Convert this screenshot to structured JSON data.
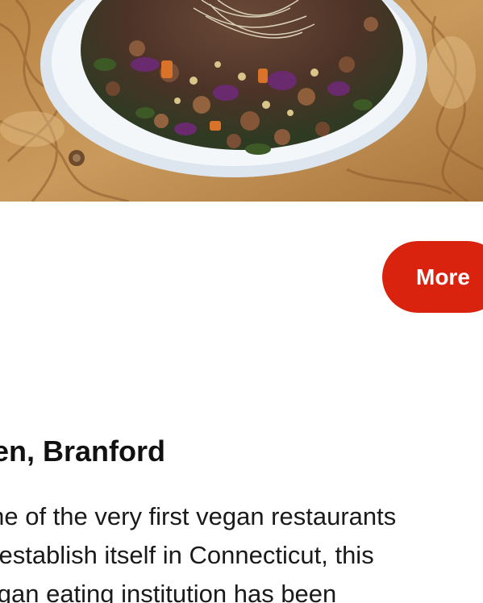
{
  "article": {
    "more_button_label": "More",
    "heading": "Zen, Branford",
    "body_lines": [
      "One of the very first vegan restaurants",
      "to establish itself in Connecticut, this",
      "vegan eating institution has been"
    ]
  },
  "photo": {
    "description_icon": "salad-bowl-photo"
  },
  "colors": {
    "accent": "#d9230f",
    "text": "#111111",
    "background": "#ffffff"
  }
}
